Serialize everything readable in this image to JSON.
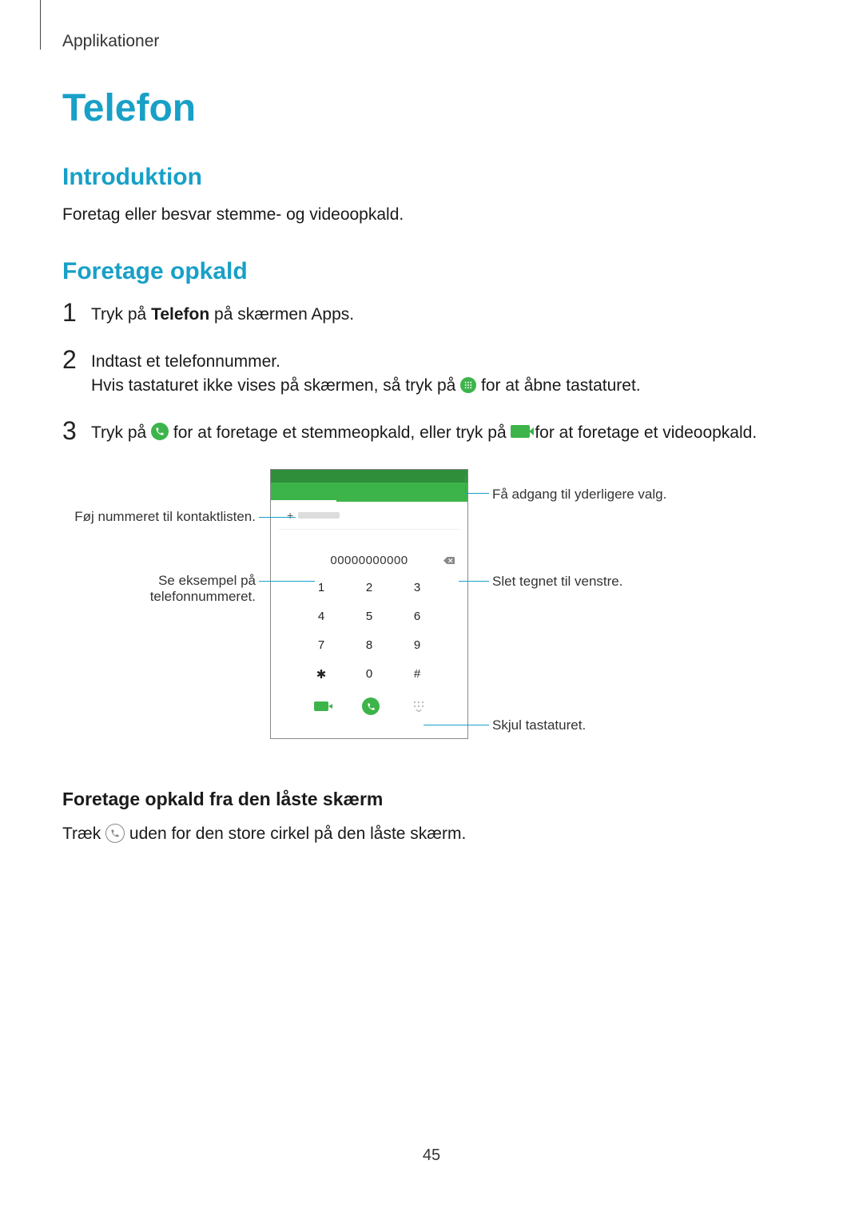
{
  "header": {
    "breadcrumb": "Applikationer"
  },
  "title": "Telefon",
  "introduction": {
    "heading": "Introduktion",
    "text": "Foretag eller besvar stemme- og videoopkald."
  },
  "making_calls": {
    "heading": "Foretage opkald",
    "steps": {
      "one": {
        "num": "1",
        "prefix": "Tryk på ",
        "bold": "Telefon",
        "suffix": " på skærmen Apps."
      },
      "two": {
        "num": "2",
        "line1": "Indtast et telefonnummer.",
        "line2a": "Hvis tastaturet ikke vises på skærmen, så tryk på ",
        "line2b": " for at åbne tastaturet."
      },
      "three": {
        "num": "3",
        "a": "Tryk på ",
        "b": " for at foretage et stemmeopkald, eller tryk på ",
        "c": " for at foretage et videoopkald."
      }
    }
  },
  "mockup": {
    "number_display": "00000000000",
    "keys": [
      "1",
      "2",
      "3",
      "4",
      "5",
      "6",
      "7",
      "8",
      "9",
      "✱",
      "0",
      "#"
    ],
    "callouts": {
      "add_contact": "Føj nummeret til kontaktlisten.",
      "preview_a": "Se eksempel på",
      "preview_b": "telefonnummeret.",
      "more_options": "Få adgang til yderligere valg.",
      "backspace": "Slet tegnet til venstre.",
      "hide_keypad": "Skjul tastaturet."
    }
  },
  "locked_screen": {
    "heading": "Foretage opkald fra den låste skærm",
    "a": "Træk ",
    "b": " uden for den store cirkel på den låste skærm."
  },
  "page_number": "45"
}
